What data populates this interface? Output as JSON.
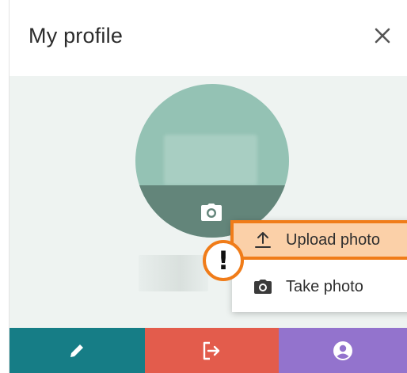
{
  "header": {
    "title": "My profile",
    "close_icon": "close-icon"
  },
  "menu": {
    "items": [
      {
        "label": "Upload photo",
        "icon": "upload-icon",
        "highlighted": true
      },
      {
        "label": "Take photo",
        "icon": "camera-icon",
        "highlighted": false
      }
    ]
  },
  "badge": {
    "text": "!"
  },
  "footer": {
    "buttons": [
      {
        "icon": "pencil-icon",
        "color": "#167d86"
      },
      {
        "icon": "logout-icon",
        "color": "#e35c4c"
      },
      {
        "icon": "account-icon",
        "color": "#9373cd"
      }
    ]
  },
  "colors": {
    "accent_orange": "#f07c19",
    "highlight": "#fbd0a8",
    "avatar": "#94c2b4",
    "avatar_band": "#63857a"
  }
}
